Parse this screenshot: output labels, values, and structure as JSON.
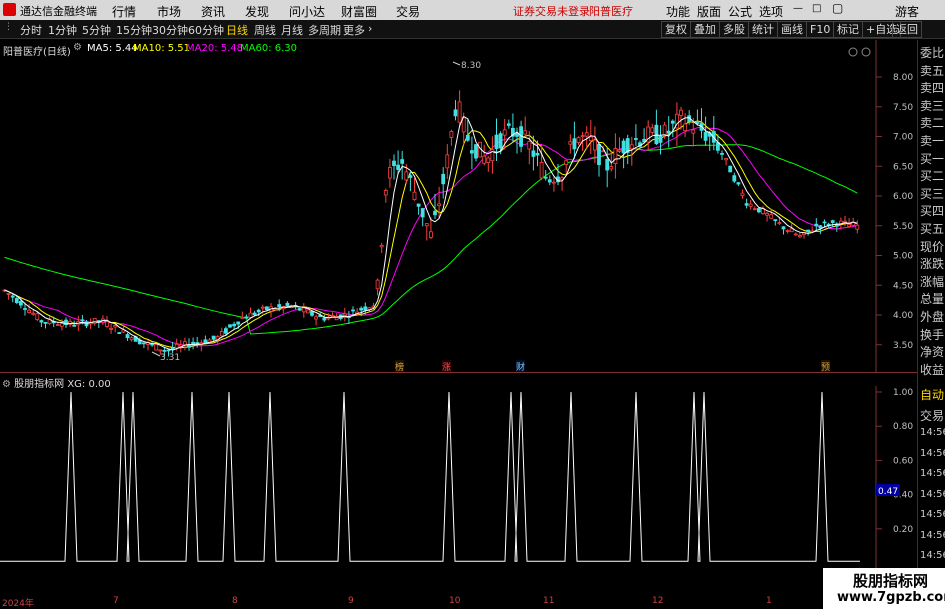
{
  "titlebar": {
    "app_name": "通达信金融终端",
    "menus": [
      "行情",
      "市场",
      "资讯",
      "发现",
      "问小达",
      "财富圈",
      "交易"
    ],
    "warning": "证券交易未登录",
    "stock": "阳普医疗",
    "right_menus": [
      "功能",
      "版面",
      "公式",
      "选项"
    ],
    "user": "游客"
  },
  "periods": [
    "分时",
    "1分钟",
    "5分钟",
    "15分钟",
    "30分钟",
    "60分钟",
    "日线",
    "周线",
    "月线",
    "多周期",
    "更多"
  ],
  "active_period": "日线",
  "toolbar_right": [
    "复权",
    "叠加",
    "多股",
    "统计",
    "画线",
    "F10",
    "标记",
    "+自选",
    "返回"
  ],
  "stock_label": "阳普医疗(日线)",
  "ma": {
    "ma5": "MA5: 5.44",
    "ma10": "MA10: 5.51",
    "ma20": "MA20: 5.48",
    "ma60": "MA60: 6.30",
    "colors": {
      "ma5": "#ffffff",
      "ma10": "#ffff00",
      "ma20": "#ff00ff",
      "ma60": "#00ff00"
    }
  },
  "price_axis": [
    "8.00",
    "7.50",
    "7.00",
    "6.50",
    "6.00",
    "5.50",
    "5.00",
    "4.50",
    "4.00",
    "3.50"
  ],
  "annotations": {
    "high": "8.30",
    "low": "3.31"
  },
  "event_tags": [
    "榜",
    "涨",
    "财",
    "预"
  ],
  "indicator": {
    "label": "股朋指标网 XG: 0.00",
    "axis": [
      "1.00",
      "0.80",
      "0.60",
      "0.40",
      "0.20"
    ],
    "current": "0.47"
  },
  "x_axis": [
    "2024年",
    "7",
    "8",
    "9",
    "10",
    "11",
    "12",
    "1"
  ],
  "right_panel": [
    "委比",
    "卖五",
    "卖四",
    "卖三",
    "卖二",
    "卖一",
    "买一",
    "买二",
    "买三",
    "买四",
    "买五",
    "现价",
    "涨跌",
    "涨幅",
    "总量",
    "外盘",
    "换手",
    "净资",
    "收益"
  ],
  "right_panel_bottom": [
    "自动",
    "交易",
    "14:56",
    "14:56",
    "14:56",
    "14:56",
    "14:56",
    "14:56",
    "14:56",
    "14:56",
    "14:56"
  ],
  "watermark": {
    "title": "股朋指标网",
    "url": "www.7gpzb.com"
  }
}
